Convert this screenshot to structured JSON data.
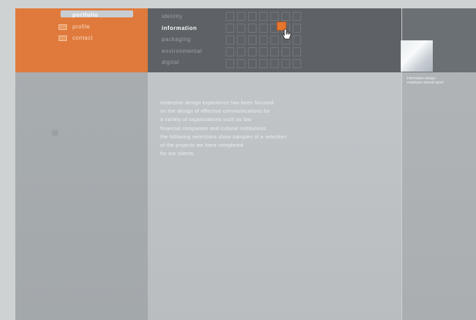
{
  "nav": {
    "items": [
      {
        "label": "portfolio",
        "active": true
      },
      {
        "label": "profile",
        "active": false
      },
      {
        "label": "contact",
        "active": false
      }
    ]
  },
  "menu": {
    "items": [
      {
        "label": "identity",
        "active": false
      },
      {
        "label": "information",
        "active": true
      },
      {
        "label": "packaging",
        "active": false
      },
      {
        "label": "environmental",
        "active": false
      },
      {
        "label": "digital",
        "active": false
      }
    ]
  },
  "sidebar": {
    "caption": "information design\nemployee annual report"
  },
  "main": {
    "text": "extensive design experience has been focused\non the design of effective communications for\na variety of organizations such as law\nfinancial companies and cultural institutions.\nthe following selections show samples of a selection\nof the projects we have completed\nfor our clients."
  },
  "colors": {
    "accent": "#e07a3c",
    "dark_panel": "#5e6266"
  },
  "icons": {
    "cursor": "hand-cursor-icon"
  }
}
